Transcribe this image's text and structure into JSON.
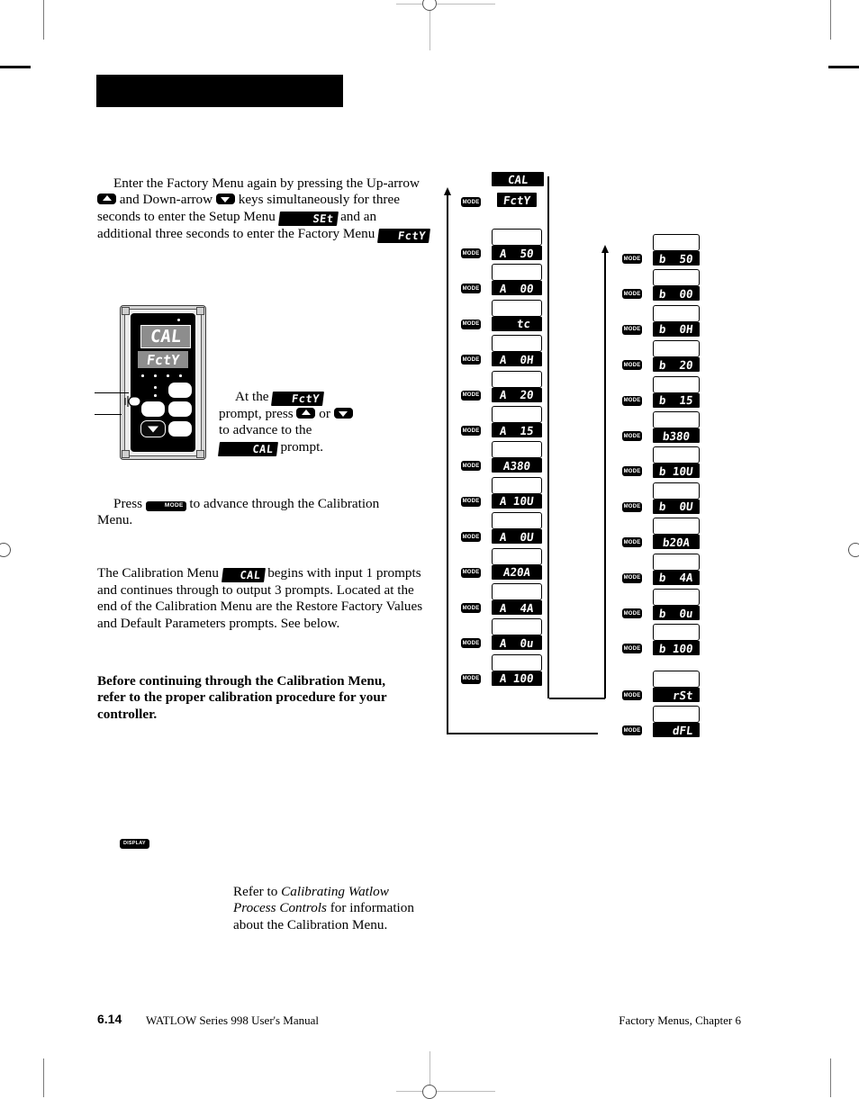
{
  "page": {
    "header_bar": "",
    "footer": {
      "page_number": "6.14",
      "manual_title": "WATLOW Series 998 User's Manual",
      "chapter": "Factory Menus, Chapter 6"
    }
  },
  "body_text": {
    "para1_part1": "Enter the Factory Menu again by pressing the Up-arrow",
    "para1_part2": "and Down-arrow",
    "para1_part3": "keys simultaneously for three seconds to enter the Setup Menu",
    "para1_set": "SEt",
    "para1_part4": "and an additional three seconds to enter the Factory Menu",
    "para1_fcty": "FctY",
    "para2_part1": "At the",
    "para2_fcty": "FctY",
    "para2_part2": "prompt, press",
    "para2_part3": "or",
    "para2_part4": "to advance to the",
    "para2_cal": "CAL",
    "para2_part5": "prompt.",
    "para3_part1": "Press",
    "para3_mode": "MODE",
    "para3_part2": "to advance through the Calibration Menu.",
    "para4_part1": "The Calibration Menu",
    "para4_cal": "CAL",
    "para4_part2": "begins with input 1 prompts and continues through to output 3 prompts. Located at the end of the Calibration Menu are the Restore Factory Values and Default Parameters prompts. See below.",
    "para5_bold": "Before continuing through the Calibration Menu, refer to the proper calibration procedure for your controller.",
    "note_part1": "Refer to ",
    "note_italic": "Calibrating Watlow Process Controls",
    "note_part2": " for information about the Calibration Menu."
  },
  "controller": {
    "main_display": "CAL",
    "sub_display": "FctY",
    "display_key_label": "DISPLAY"
  },
  "flowchart": {
    "mode_label": "MODE",
    "column_left": {
      "head": [
        {
          "led": "CAL",
          "lead_block": true
        },
        {
          "led": "FctY",
          "mode": true
        }
      ],
      "steps": [
        {
          "box": true,
          "led": "A  50",
          "mode": true
        },
        {
          "box": true,
          "led": "A  00",
          "mode": true
        },
        {
          "box": true,
          "led": "tc",
          "mode": true,
          "lead_block": true
        },
        {
          "box": true,
          "led": "A  0H",
          "mode": true
        },
        {
          "box": true,
          "led": "A  20",
          "mode": true
        },
        {
          "box": true,
          "led": "A  15",
          "mode": true
        },
        {
          "box": true,
          "led": "A380",
          "mode": true
        },
        {
          "box": true,
          "led": "A 10U",
          "mode": true
        },
        {
          "box": true,
          "led": "A  0U",
          "mode": true
        },
        {
          "box": true,
          "led": "A20A",
          "mode": true
        },
        {
          "box": true,
          "led": "A  4A",
          "mode": true
        },
        {
          "box": true,
          "led": "A  0u",
          "mode": true
        },
        {
          "box": true,
          "led": "A 100",
          "mode": true
        }
      ]
    },
    "column_right": {
      "steps": [
        {
          "box": true,
          "led": "b  50",
          "mode": true
        },
        {
          "box": true,
          "led": "b  00",
          "mode": true
        },
        {
          "box": true,
          "led": "b  0H",
          "mode": true
        },
        {
          "box": true,
          "led": "b  20",
          "mode": true
        },
        {
          "box": true,
          "led": "b  15",
          "mode": true
        },
        {
          "box": true,
          "led": "b380",
          "mode": true
        },
        {
          "box": true,
          "led": "b 10U",
          "mode": true
        },
        {
          "box": true,
          "led": "b  0U",
          "mode": true
        },
        {
          "box": true,
          "led": "b20A",
          "mode": true
        },
        {
          "box": true,
          "led": "b  4A",
          "mode": true
        },
        {
          "box": true,
          "led": "b  0u",
          "mode": true
        },
        {
          "box": true,
          "led": "b 100",
          "mode": true
        },
        {
          "box": true,
          "led": "rSt",
          "mode": true,
          "lead_block": true
        },
        {
          "box": true,
          "led": "dFL",
          "mode": true,
          "lead_block": true
        }
      ]
    }
  },
  "colors": {
    "ink": "#000000",
    "paper": "#ffffff",
    "lcd_gray": "#8d8d8d",
    "bezel_gray": "#d6d6d6"
  }
}
